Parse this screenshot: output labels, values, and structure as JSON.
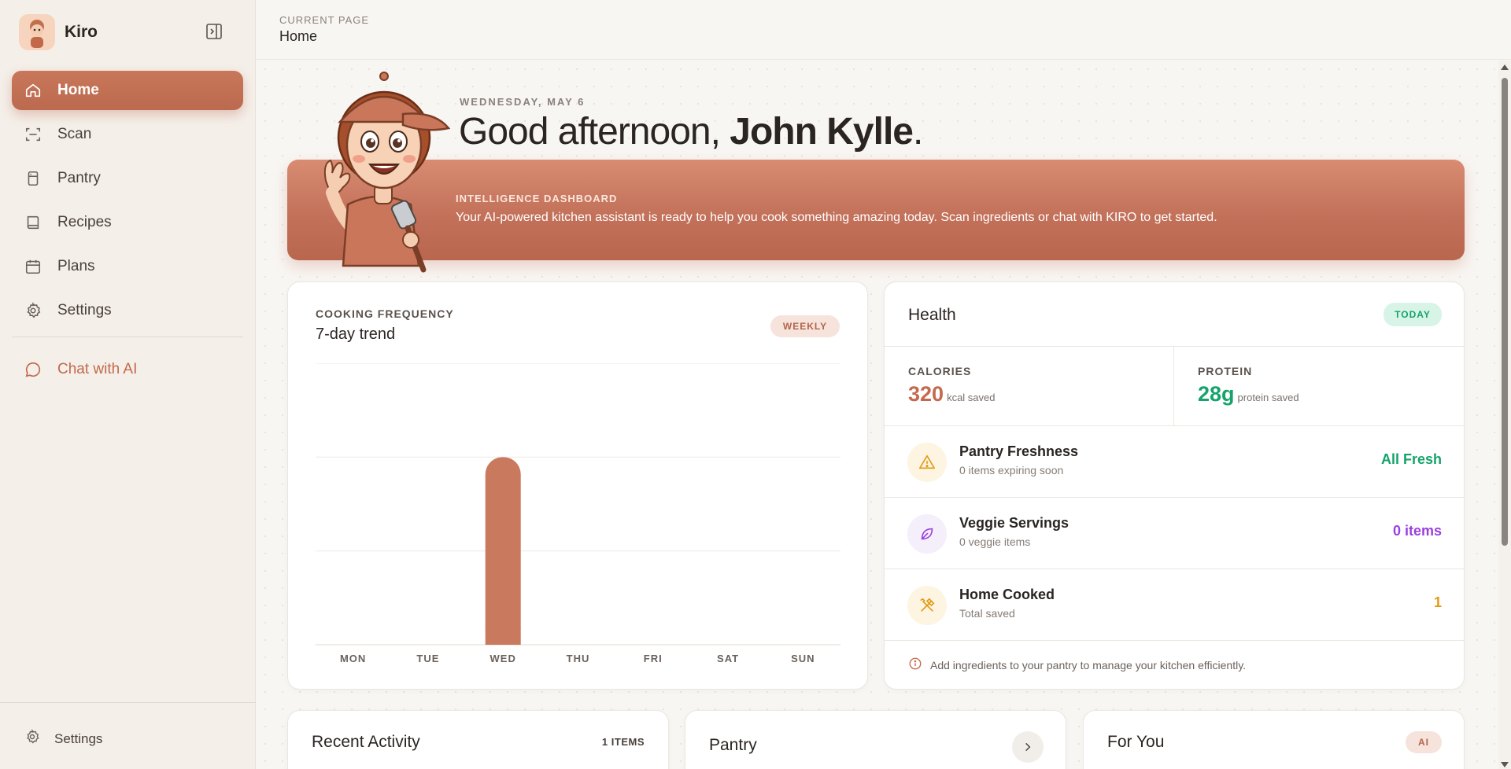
{
  "app": {
    "name": "Kiro"
  },
  "sidebar": {
    "items": [
      {
        "label": "Home",
        "icon": "home-icon",
        "active": true
      },
      {
        "label": "Scan",
        "icon": "scan-icon"
      },
      {
        "label": "Pantry",
        "icon": "pantry-icon"
      },
      {
        "label": "Recipes",
        "icon": "book-icon"
      },
      {
        "label": "Plans",
        "icon": "calendar-icon"
      },
      {
        "label": "Settings",
        "icon": "gear-icon"
      }
    ],
    "chat_label": "Chat with AI",
    "footer_settings_label": "Settings"
  },
  "header": {
    "crumb_label": "CURRENT PAGE",
    "crumb_value": "Home"
  },
  "greeting": {
    "date": "WEDNESDAY, MAY 6",
    "prefix": "Good afternoon, ",
    "name": "John Kylle",
    "suffix": "."
  },
  "banner": {
    "title": "INTELLIGENCE DASHBOARD",
    "text": "Your AI-powered kitchen assistant is ready to help you cook something amazing today. Scan ingredients or chat with KIRO to get started."
  },
  "frequency": {
    "label": "COOKING FREQUENCY",
    "title": "7-day trend",
    "badge": "WEEKLY"
  },
  "chart_data": {
    "type": "bar",
    "categories": [
      "MON",
      "TUE",
      "WED",
      "THU",
      "FRI",
      "SAT",
      "SUN"
    ],
    "values": [
      0,
      0,
      1,
      0,
      0,
      0,
      0
    ],
    "ylim": [
      0,
      1.5
    ],
    "grid": true,
    "bar_color": "#c97a5e"
  },
  "health": {
    "title": "Health",
    "badge": "TODAY",
    "calories": {
      "label": "CALORIES",
      "value": "320",
      "unit": "kcal saved",
      "color": "#c4694c"
    },
    "protein": {
      "label": "PROTEIN",
      "value": "28g",
      "unit": "protein saved",
      "color": "#15a36b"
    },
    "rows": [
      {
        "title": "Pantry Freshness",
        "sub": "0 items expiring soon",
        "value": "All Fresh",
        "value_color": "#15a36b",
        "icon": "warning-icon",
        "icon_bg": "#fdf4e1"
      },
      {
        "title": "Veggie Servings",
        "sub": "0 veggie items",
        "value": "0 items",
        "value_color": "#9a3fe0",
        "icon": "leaf-icon",
        "icon_bg": "#f5eefb"
      },
      {
        "title": "Home Cooked",
        "sub": "Total saved",
        "value": "1",
        "value_color": "#e39a14",
        "icon": "utensils-icon",
        "icon_bg": "#fdf4e1"
      }
    ],
    "note": "Add ingredients to your pantry to manage your kitchen efficiently."
  },
  "bottom": {
    "recent": {
      "title": "Recent Activity",
      "meta": "1 ITEMS"
    },
    "pantry": {
      "title": "Pantry"
    },
    "foryou": {
      "title": "For You",
      "badge": "AI"
    }
  },
  "colors": {
    "accent": "#c4694c",
    "green": "#15a36b",
    "purple": "#9a3fe0",
    "amber": "#e39a14"
  }
}
